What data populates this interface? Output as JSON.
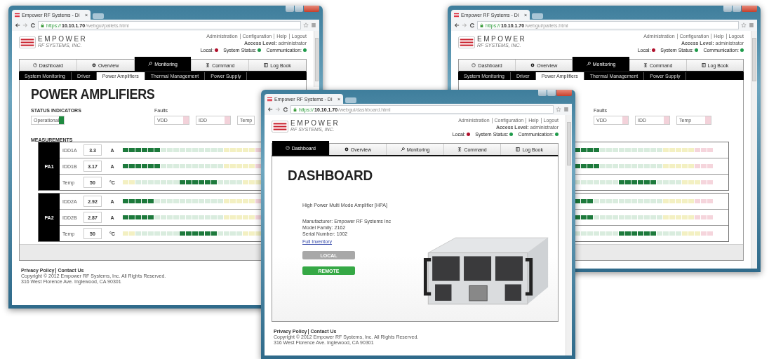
{
  "windows": [
    {
      "tab_title": "Empower RF Systems - Di",
      "tab_close": "×",
      "address": {
        "scheme": "https://",
        "host": "10.10.1.70",
        "path": "/webgui/pallets.html"
      },
      "header": {
        "company": "EMPOWER",
        "subtitle": "RF SYSTEMS, INC.",
        "links": [
          "Administration",
          "Configuration",
          "Help",
          "Logout"
        ],
        "access": "**Access Level:** administrator",
        "statuses": [
          {
            "label": "Local:",
            "color": "#b0102c"
          },
          {
            "label": "System Status:",
            "color": "#1f9a4a"
          },
          {
            "label": "Communication:",
            "color": "#1f9a4a"
          }
        ]
      },
      "nav": [
        {
          "label": "Dashboard",
          "selected": false
        },
        {
          "label": "Overview",
          "selected": false
        },
        {
          "label": "Monitoring",
          "selected": true
        },
        {
          "label": "Command",
          "selected": false
        },
        {
          "label": "Log Book",
          "selected": false
        }
      ],
      "subnav": [
        {
          "label": "System Monitoring",
          "selected": false
        },
        {
          "label": "Driver",
          "selected": false
        },
        {
          "label": "Power Amplifiers",
          "selected": true
        },
        {
          "label": "Thermal Management",
          "selected": false
        },
        {
          "label": "Power Supply",
          "selected": false
        }
      ],
      "page": {
        "kind": "pallets",
        "title": "POWER AMPLIFIERS",
        "status_label": "STATUS INDICATORS",
        "status": [
          {
            "label": "Operational",
            "on": true
          }
        ],
        "faults_label": "Faults",
        "faults": [
          {
            "label": "VDD",
            "on": false
          },
          {
            "label": "IDD",
            "on": false
          },
          {
            "label": "Temp"
          }
        ],
        "measurements_label": "MEASUREMENTS",
        "groups": [
          {
            "name": "PA1",
            "rows": [
              {
                "label": "IDD1A",
                "value": "3.3",
                "unit": "A",
                "kind": "current",
                "level": 0.25
              },
              {
                "label": "IDD1B",
                "value": "3.17",
                "unit": "A",
                "kind": "current",
                "level": 0.25
              },
              {
                "label": "Temp",
                "value": "50",
                "unit": "°C",
                "kind": "temp",
                "level": 0.5
              }
            ]
          },
          {
            "name": "PA2",
            "rows": [
              {
                "label": "IDD2A",
                "value": "2.92",
                "unit": "A",
                "kind": "current",
                "level": 0.21
              },
              {
                "label": "IDD2B",
                "value": "2.87",
                "unit": "A",
                "kind": "current",
                "level": 0.21
              },
              {
                "label": "Temp",
                "value": "50",
                "unit": "°C",
                "kind": "temp",
                "level": 0.5
              }
            ]
          }
        ]
      },
      "footer": {
        "links": [
          "Privacy Policy",
          "Contact Us"
        ],
        "lines": [
          "Copyright © 2012 Empower RF Systems, Inc. All Rights Reserved.",
          "316 West Florence Ave. Inglewood, CA 90301"
        ]
      }
    },
    {
      "tab_title": "Empower RF Systems - Di",
      "tab_close": "×",
      "address": {
        "scheme": "https://",
        "host": "10.10.1.70",
        "path": "/webgui/dashboard.html"
      },
      "header": {
        "company": "EMPOWER",
        "subtitle": "RF SYSTEMS, INC.",
        "links": [
          "Administration",
          "Configuration",
          "Help",
          "Logout"
        ],
        "access": "**Access Level:** administrator",
        "statuses": [
          {
            "label": "Local:",
            "color": "#b0102c"
          },
          {
            "label": "System Status:",
            "color": "#1f9a4a"
          },
          {
            "label": "Communication:",
            "color": "#1f9a4a"
          }
        ]
      },
      "nav": [
        {
          "label": "Dashboard",
          "selected": true
        },
        {
          "label": "Overview",
          "selected": false
        },
        {
          "label": "Monitoring",
          "selected": false
        },
        {
          "label": "Command",
          "selected": false
        },
        {
          "label": "Log Book",
          "selected": false
        }
      ],
      "page": {
        "kind": "dashboard",
        "title": "DASHBOARD",
        "product": "High Power Multi Mode Amplifier [HPA]",
        "info": [
          "Manufacturer: Empower RF Systems Inc",
          "Model Family: 2162",
          "Serial Number: 1002"
        ],
        "link": "Full Inventory",
        "modes": [
          {
            "label": "LOCAL",
            "selected": false
          },
          {
            "label": "REMOTE",
            "selected": true
          }
        ]
      },
      "footer": {
        "links": [
          "Privacy Policy",
          "Contact Us"
        ],
        "lines": [
          "Copyright © 2012 Empower RF Systems, Inc. All Rights Reserved.",
          "316 West Florence Ave. Inglewood, CA 90301"
        ]
      }
    },
    {
      "tab_title": "Empower RF Systems - Di",
      "tab_close": "×",
      "address": {
        "scheme": "https://",
        "host": "10.10.1.70",
        "path": "/webgui/pallets.html"
      },
      "header": {
        "company": "EMPOWER",
        "subtitle": "RF SYSTEMS, INC.",
        "links": [
          "Administration",
          "Configuration",
          "Help",
          "Logout"
        ],
        "access": "**Access Level:** administrator",
        "statuses": [
          {
            "label": "Local:",
            "color": "#b0102c"
          },
          {
            "label": "System Status:",
            "color": "#1f9a4a"
          },
          {
            "label": "Communication:",
            "color": "#1f9a4a"
          }
        ]
      },
      "nav": [
        {
          "label": "Dashboard",
          "selected": false
        },
        {
          "label": "Overview",
          "selected": false
        },
        {
          "label": "Monitoring",
          "selected": true
        },
        {
          "label": "Command",
          "selected": false
        },
        {
          "label": "Log Book",
          "selected": false
        }
      ],
      "subnav": [
        {
          "label": "System Monitoring",
          "selected": false
        },
        {
          "label": "Driver",
          "selected": false
        },
        {
          "label": "Power Amplifiers",
          "selected": true
        },
        {
          "label": "Thermal Management",
          "selected": false
        },
        {
          "label": "Power Supply",
          "selected": false
        }
      ],
      "page": {
        "kind": "pallets",
        "faults_label": "Faults",
        "faults": [
          {
            "label": "VDD",
            "on": false
          },
          {
            "label": "IDD",
            "on": false
          },
          {
            "label": "Temp",
            "on": false
          }
        ],
        "groups": [
          {
            "rows": [
              {
                "kind": "current",
                "level": 0.25
              },
              {
                "kind": "current",
                "level": 0.25
              },
              {
                "kind": "temp",
                "level": 0.5
              }
            ]
          },
          {
            "rows": [
              {
                "kind": "current",
                "level": 0.21
              },
              {
                "kind": "current",
                "level": 0.21
              },
              {
                "kind": "temp",
                "level": 0.5
              }
            ]
          }
        ]
      }
    }
  ]
}
